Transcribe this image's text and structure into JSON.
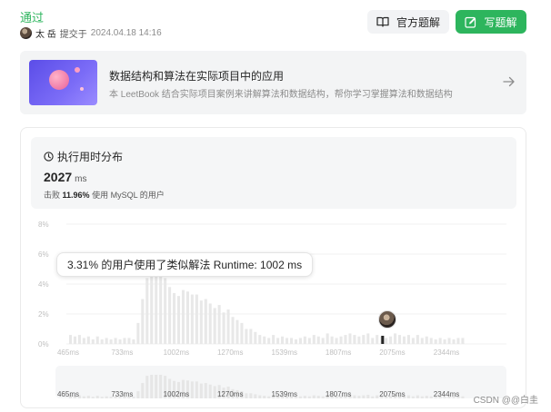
{
  "submission": {
    "status": "通过",
    "user": "太 岳",
    "action": "提交于",
    "time": "2024.04.18 14:16"
  },
  "buttons": {
    "official_solution": "官方题解",
    "write_solution": "写题解"
  },
  "leetbook": {
    "title": "数据结构和算法在实际项目中的应用",
    "subtitle": "本 LeetBook 结合实际项目案例来讲解算法和数据结构，帮你学习掌握算法和数据结构"
  },
  "runtime": {
    "label": "执行用时分布",
    "value": "2027",
    "unit": "ms",
    "beat_prefix": "击败",
    "beat_percent": "11.96%",
    "beat_suffix": "使用 MySQL 的用户"
  },
  "tooltip": {
    "text": "3.31% 的用户使用了类似解法 Runtime: 1002 ms"
  },
  "chart_data": {
    "type": "bar",
    "y_ticks": [
      "0%",
      "2%",
      "4%",
      "6%",
      "8%"
    ],
    "ylim": [
      0,
      8
    ],
    "x_ticks": [
      "465ms",
      "733ms",
      "1002ms",
      "1270ms",
      "1539ms",
      "1807ms",
      "2075ms",
      "2344ms"
    ],
    "x_tick_values": [
      465,
      733,
      1002,
      1270,
      1539,
      1807,
      2075,
      2344
    ],
    "bin_start": 465,
    "bin_step": 22.4,
    "values": [
      0.6,
      0.5,
      0.6,
      0.4,
      0.5,
      0.3,
      0.5,
      0.3,
      0.4,
      0.3,
      0.4,
      0.3,
      0.4,
      0.4,
      0.3,
      1.4,
      3.0,
      4.4,
      4.6,
      4.6,
      4.6,
      4.4,
      3.8,
      3.4,
      3.2,
      3.6,
      3.5,
      3.3,
      3.3,
      2.9,
      3.0,
      2.7,
      2.4,
      2.6,
      2.1,
      2.3,
      1.8,
      1.6,
      1.4,
      1.0,
      1.0,
      0.8,
      0.6,
      0.5,
      0.4,
      0.6,
      0.4,
      0.5,
      0.4,
      0.4,
      0.3,
      0.4,
      0.5,
      0.4,
      0.6,
      0.5,
      0.4,
      0.7,
      0.5,
      0.4,
      0.5,
      0.6,
      0.7,
      0.6,
      0.5,
      0.6,
      0.7,
      0.4,
      0.6,
      0.5,
      0.4,
      0.5,
      0.7,
      0.6,
      0.5,
      0.6,
      0.4,
      0.6,
      0.4,
      0.5,
      0.4,
      0.3,
      0.4,
      0.3,
      0.4,
      0.3,
      0.4,
      0.4
    ],
    "highlight_bin_value": 2027,
    "bar_color": "#e8e8e8",
    "highlight_color": "#262626"
  },
  "watermark": "CSDN @@白圭"
}
